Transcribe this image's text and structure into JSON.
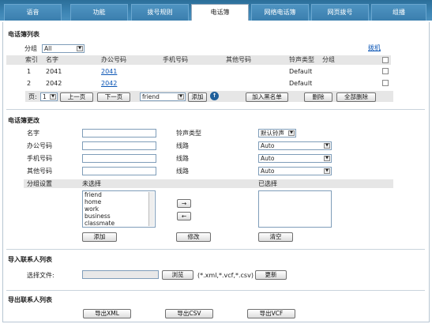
{
  "tabs": [
    "语音",
    "功能",
    "拨号规则",
    "电话簿",
    "网络电话簿",
    "网页拨号",
    "组播"
  ],
  "active_tab": "电话簿",
  "list": {
    "title": "电话簿列表",
    "group_label": "分组",
    "group_value": "All",
    "dial_link": "拨机",
    "headers": [
      "索引",
      "名字",
      "办公号码",
      "手机号码",
      "其他号码",
      "铃声类型",
      "分组"
    ],
    "rows": [
      {
        "index": "1",
        "name": "2041",
        "office": "2041",
        "ring": "Default"
      },
      {
        "index": "2",
        "name": "2042",
        "office": "2042",
        "ring": "Default"
      }
    ],
    "page_label": "页:",
    "page_value": "1",
    "prev_btn": "上一页",
    "next_btn": "下一页",
    "group_select": "friend",
    "add_btn": "添加",
    "blacklist_btn": "加入黑名单",
    "delete_btn": "删除",
    "delete_all_btn": "全部删除"
  },
  "edit": {
    "title": "电话簿更改",
    "name_label": "名字",
    "office_label": "办公号码",
    "mobile_label": "手机号码",
    "other_label": "其他号码",
    "ring_label": "铃声类型",
    "ring_value": "默认铃声",
    "line_label": "线路",
    "line_value": "Auto",
    "group_setting_label": "分组设置",
    "unselected_label": "未选择",
    "selected_label": "已选择",
    "groups": [
      "friend",
      "home",
      "work",
      "business",
      "classmate"
    ],
    "add_btn": "添加",
    "modify_btn": "修改",
    "clear_btn": "清空",
    "move_right": "→",
    "move_left": "←"
  },
  "import": {
    "title": "导入联系人列表",
    "file_label": "选择文件:",
    "browse_btn": "浏览",
    "ext_hint": "(*.xml,*.vcf,*.csv)",
    "update_btn": "更新"
  },
  "export": {
    "title": "导出联系人列表",
    "xml_btn": "导出XML",
    "csv_btn": "导出CSV",
    "vcf_btn": "导出VCF"
  }
}
